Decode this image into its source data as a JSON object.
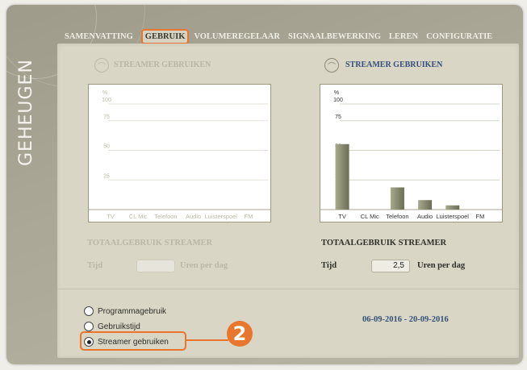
{
  "side_title": "GEHEUGEN",
  "tabs": [
    "SAMENVATTING",
    "GEBRUIK",
    "VOLUMEREGELAAR",
    "SIGNAALBEWERKING",
    "LEREN",
    "CONFIGURATIE"
  ],
  "active_tab": "GEBRUIK",
  "colors": {
    "accent": "#e8762c",
    "title_blue": "#34507a",
    "bar": "#77785f",
    "disabled": "#b9b6a5"
  },
  "left_section": {
    "title": "STREAMER GEBRUIKEN",
    "total_title": "TOTAALGEBRUIK STREAMER",
    "time_label": "Tijd",
    "time_value": "",
    "unit_label": "Uren per dag"
  },
  "right_section": {
    "title": "STREAMER GEBRUIKEN",
    "total_title": "TOTAALGEBRUIK STREAMER",
    "time_label": "Tijd",
    "time_value": "2,5",
    "unit_label": "Uren per dag"
  },
  "radio_options": [
    {
      "label": "Programmagebruik",
      "selected": false
    },
    {
      "label": "Gebruikstijd",
      "selected": false
    },
    {
      "label": "Streamer gebruiken",
      "selected": true
    }
  ],
  "date_range": "06-09-2016 - 20-09-2016",
  "callout_number": "2",
  "chart_data": [
    {
      "type": "bar",
      "ylabel": "%",
      "ylim": [
        0,
        100
      ],
      "yticks": [
        25,
        50,
        75,
        100
      ],
      "categories": [
        "TV",
        "CL Mic",
        "Telefoon",
        "Audio",
        "Luisterspoel",
        "FM"
      ],
      "values": [
        0,
        0,
        0,
        0,
        0,
        0
      ],
      "disabled": true
    },
    {
      "type": "bar",
      "ylabel": "%",
      "ylim": [
        0,
        100
      ],
      "yticks": [
        25,
        50,
        75,
        100
      ],
      "categories": [
        "TV",
        "CL Mic",
        "Telefoon",
        "Audio",
        "Luisterspoel",
        "FM"
      ],
      "values": [
        62,
        0,
        21,
        9,
        4,
        0
      ],
      "disabled": false
    }
  ]
}
